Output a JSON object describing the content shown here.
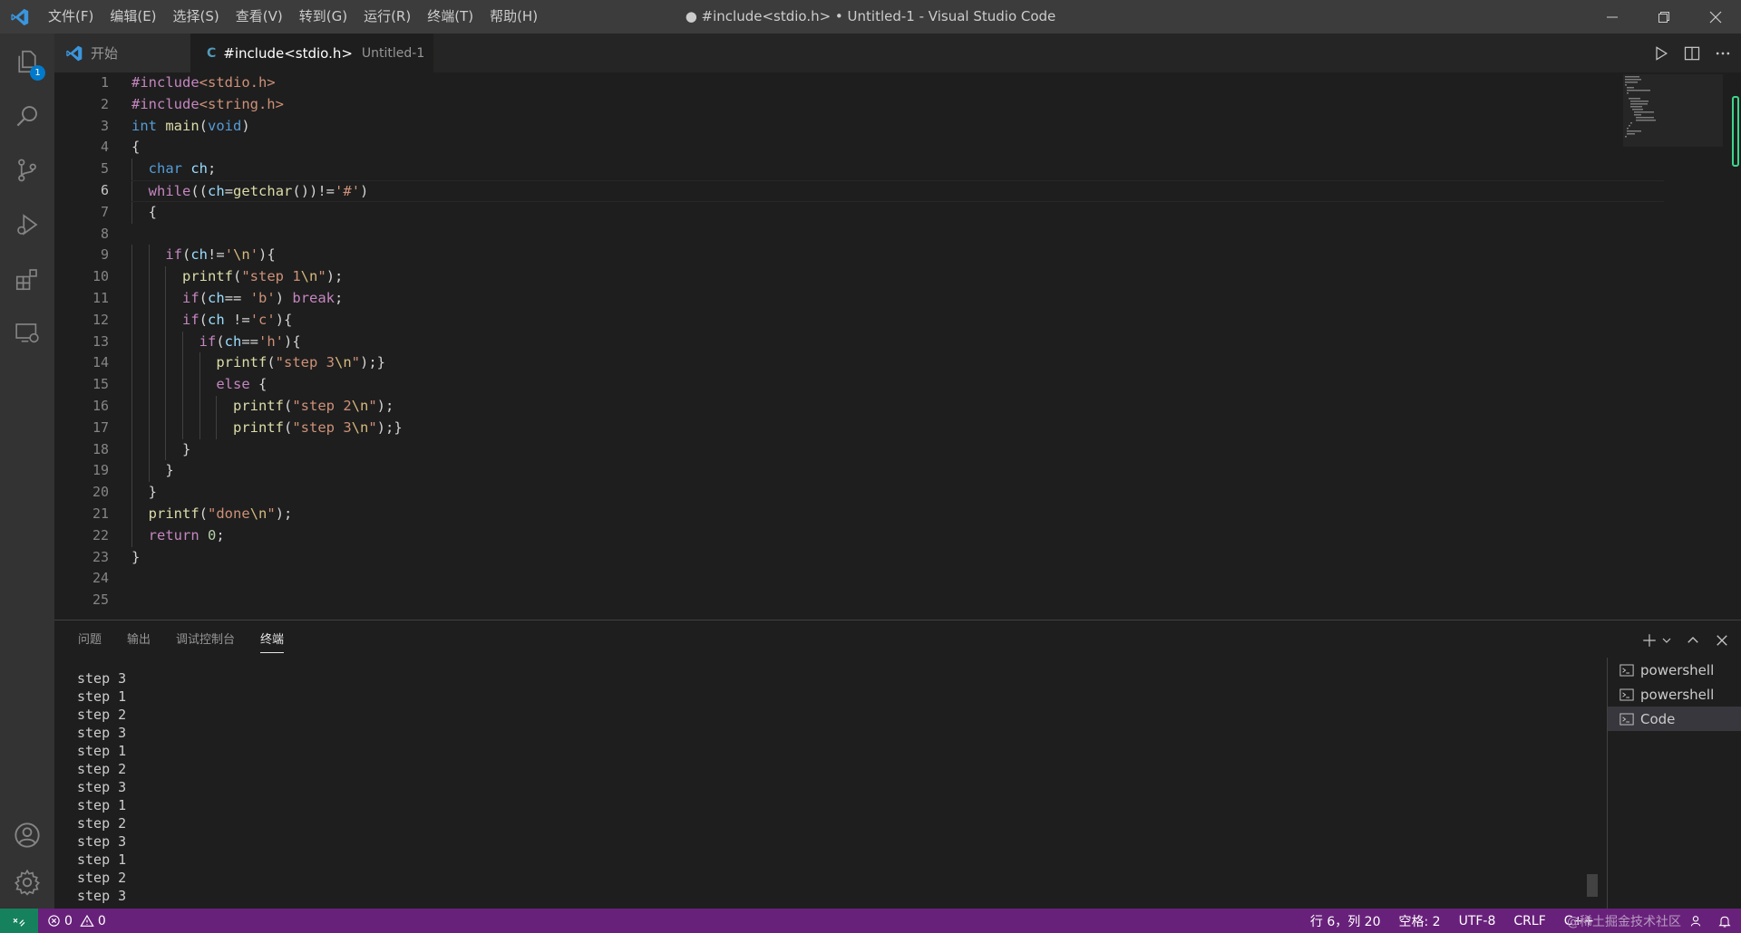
{
  "window": {
    "title": "● #include<stdio.h> • Untitled-1 - Visual Studio Code",
    "menu": [
      "文件(F)",
      "编辑(E)",
      "选择(S)",
      "查看(V)",
      "转到(G)",
      "运行(R)",
      "终端(T)",
      "帮助(H)"
    ]
  },
  "activity_bar": {
    "explorer_badge": "1",
    "items": [
      "explorer",
      "search",
      "source-control",
      "run-and-debug",
      "extensions",
      "remote-explorer",
      "accounts",
      "manage"
    ]
  },
  "tabs": [
    {
      "label": "开始",
      "active": false
    },
    {
      "label": "#include<stdio.h>",
      "description": "Untitled-1",
      "active": true,
      "dirty": true
    }
  ],
  "editor": {
    "active_line": 6,
    "line_numbers": [
      "1",
      "2",
      "3",
      "4",
      "5",
      "6",
      "7",
      "8",
      "9",
      "10",
      "11",
      "12",
      "13",
      "14",
      "15",
      "16",
      "17",
      "18",
      "19",
      "20",
      "21",
      "22",
      "23",
      "24",
      "25"
    ],
    "lines": [
      "#include<stdio.h>",
      "#include<string.h>",
      "int main(void)",
      "{",
      "  char ch;",
      "  while((ch=getchar())!='#')",
      "  {",
      "",
      "    if(ch!='\\n'){",
      "      printf(\"step 1\\n\");",
      "      if(ch== 'b') break;",
      "      if(ch !='c'){",
      "        if(ch=='h'){",
      "          printf(\"step 3\\n\");}",
      "          else {",
      "            printf(\"step 2\\n\");",
      "            printf(\"step 3\\n\");}",
      "      }",
      "    }",
      "  }",
      "  printf(\"done\\n\");",
      "  return 0;",
      "}",
      "",
      ""
    ]
  },
  "panel": {
    "tabs": [
      "问题",
      "输出",
      "调试控制台",
      "终端"
    ],
    "active_tab": "终端",
    "terminal_output": [
      "step 3",
      "step 1",
      "step 2",
      "step 3",
      "step 1",
      "step 2",
      "step 3",
      "step 1",
      "step 2",
      "step 3",
      "step 1",
      "step 2",
      "step 3"
    ],
    "terminals": [
      {
        "label": "powershell",
        "selected": false
      },
      {
        "label": "powershell",
        "selected": false
      },
      {
        "label": "Code",
        "selected": true
      }
    ]
  },
  "status_bar": {
    "errors": "0",
    "warnings": "0",
    "position": "行 6，列 20",
    "indent": "空格: 2",
    "encoding": "UTF-8",
    "eol": "CRLF",
    "language": "C++",
    "watermark": "@稀土掘金技术社区"
  },
  "colors": {
    "status_bar": "#68217a",
    "remote": "#16825d",
    "accent": "#007acc"
  }
}
